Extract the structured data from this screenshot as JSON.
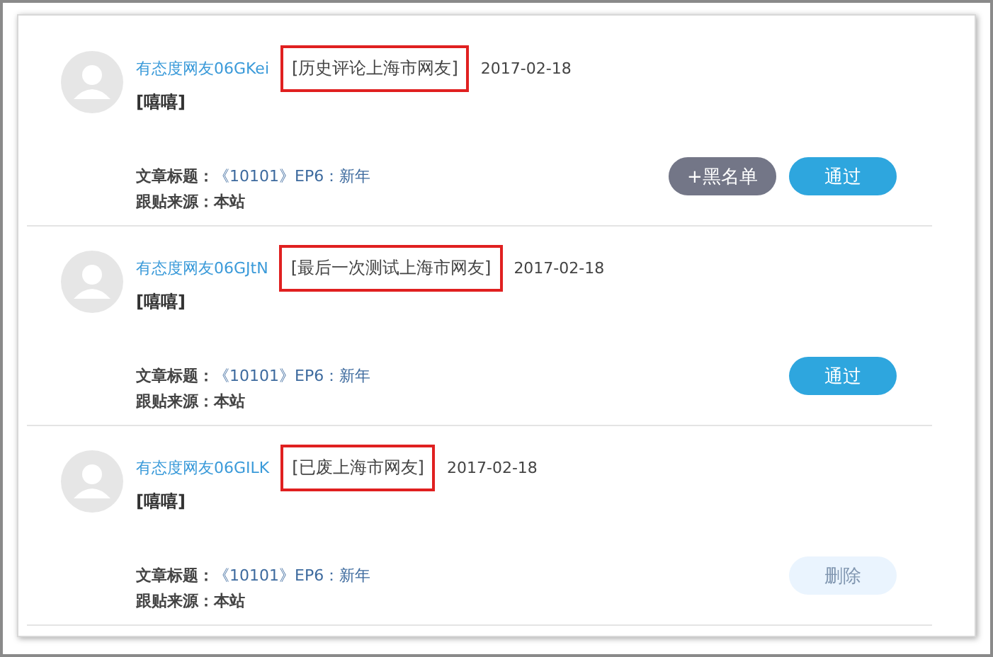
{
  "comments": [
    {
      "author": "有态度网友06GKei",
      "tag": "[历史评论上海市网友]",
      "tag_boxed": true,
      "date": "2017-02-18",
      "content": "[嘻嘻]",
      "article_label": "文章标题：",
      "article_title": "《10101》EP6：新年",
      "source_label": "跟贴来源：",
      "source": "本站",
      "buttons": [
        {
          "kind": "blacklist",
          "label": "+黑名单"
        },
        {
          "kind": "approve",
          "label": "通过"
        }
      ]
    },
    {
      "author": "有态度网友06GJtN",
      "tag": "[最后一次测试上海市网友]",
      "tag_boxed": true,
      "date": "2017-02-18",
      "content": "[嘻嘻]",
      "article_label": "文章标题：",
      "article_title": "《10101》EP6：新年",
      "source_label": "跟贴来源：",
      "source": "本站",
      "buttons": [
        {
          "kind": "approve",
          "label": "通过"
        }
      ]
    },
    {
      "author": "有态度网友06GILK",
      "tag": "[已废上海市网友]",
      "tag_boxed": true,
      "date": "2017-02-18",
      "content": "[嘻嘻]",
      "article_label": "文章标题：",
      "article_title": "《10101》EP6：新年",
      "source_label": "跟贴来源：",
      "source": "本站",
      "buttons": [
        {
          "kind": "delete",
          "label": "删除"
        }
      ]
    }
  ]
}
